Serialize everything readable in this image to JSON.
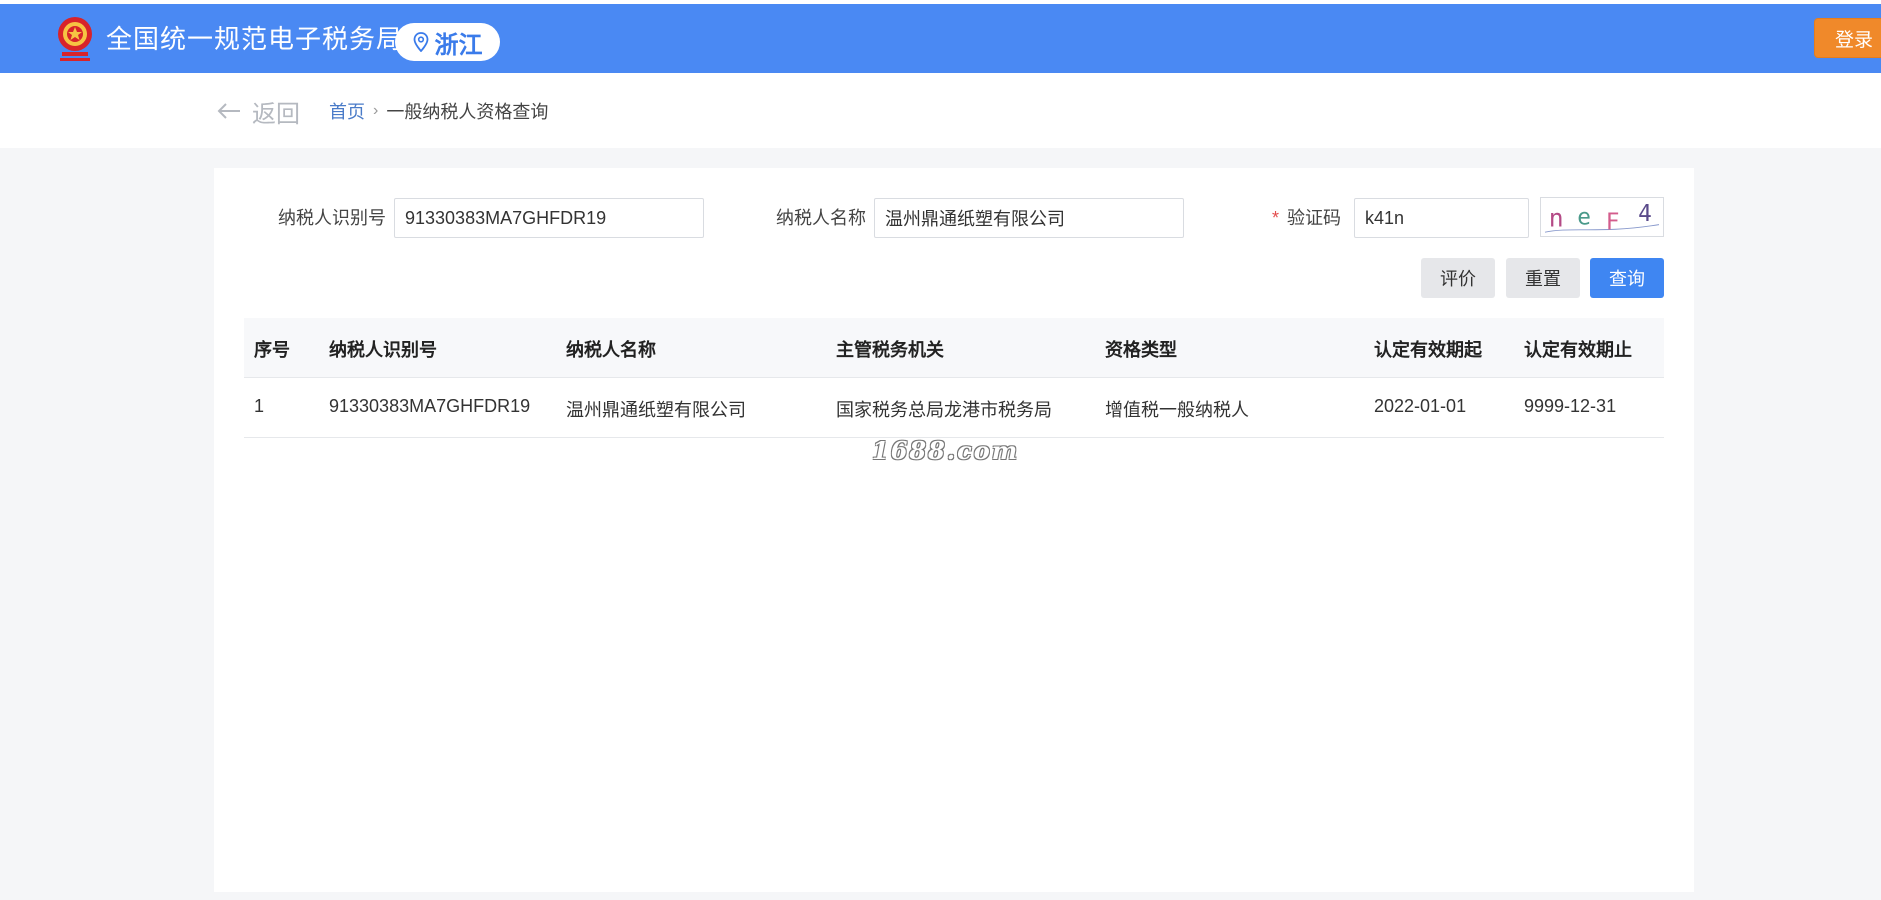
{
  "header": {
    "site_title": "全国统一规范电子税务局",
    "region": "浙江",
    "login_label": "登录",
    "emblem_icon": "national-emblem-icon",
    "location_icon": "location-pin-icon",
    "brand_color": "#4a89f3"
  },
  "nav": {
    "back_label": "返回",
    "breadcrumb_home": "首页",
    "breadcrumb_separator": "›",
    "breadcrumb_current": "一般纳税人资格查询"
  },
  "form": {
    "taxpayer_id_label": "纳税人识别号",
    "taxpayer_id_value": "91330383MA7GHFDR19",
    "taxpayer_name_label": "纳税人名称",
    "taxpayer_name_value": "温州鼎通纸塑有限公司",
    "required_mark": "*",
    "captcha_label": "验证码",
    "captcha_value": "k41n",
    "captcha_image_chars": [
      "n",
      "e",
      "F",
      "4"
    ]
  },
  "buttons": {
    "evaluate_label": "评价",
    "reset_label": "重置",
    "query_label": "查询"
  },
  "table": {
    "headers": [
      "序号",
      "纳税人识别号",
      "纳税人名称",
      "主管税务机关",
      "资格类型",
      "认定有效期起",
      "认定有效期止"
    ],
    "rows": [
      [
        "1",
        "91330383MA7GHFDR19",
        "温州鼎通纸塑有限公司",
        "国家税务总局龙港市税务局",
        "增值税一般纳税人",
        "2022-01-01",
        "9999-12-31"
      ]
    ]
  },
  "watermark": "1688.com"
}
